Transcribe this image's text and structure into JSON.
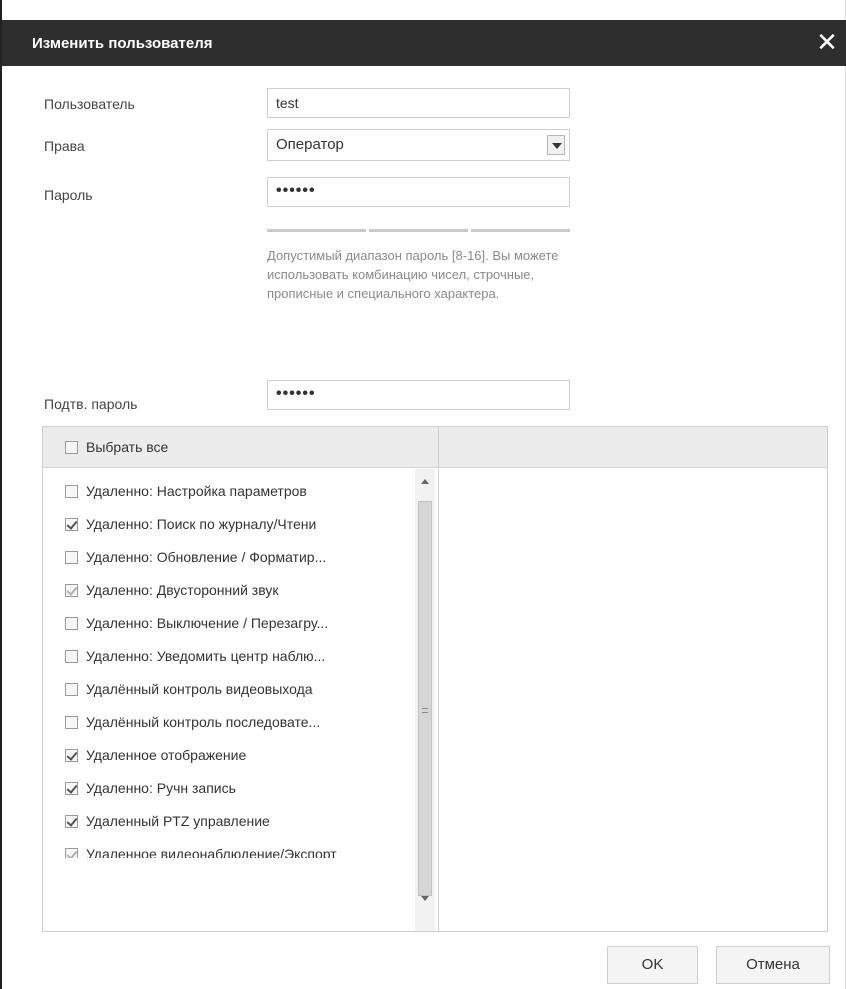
{
  "dialog": {
    "title": "Изменить пользователя",
    "close_icon": "close-icon"
  },
  "form": {
    "user_label": "Пользователь",
    "user_value": "test",
    "rights_label": "Права",
    "rights_selected": "Оператор",
    "password_label": "Пароль",
    "password_value": "••••••",
    "password_hint": "Допустимый диапазон пароль [8-16]. Вы можете использовать комбинацию чисел, строчные, прописные и специального характера.",
    "confirm_label": "Подтв. пароль",
    "confirm_value": "••••••"
  },
  "permissions": {
    "select_all_label": "Выбрать все",
    "select_all_checked": false,
    "items": [
      {
        "label": "Удаленно: Настройка параметров",
        "checked": false
      },
      {
        "label": "Удаленно: Поиск по журналу/Чтени",
        "checked": true
      },
      {
        "label": "Удаленно: Обновление / Форматир...",
        "checked": false
      },
      {
        "label": "Удаленно: Двусторонний звук",
        "checked": true,
        "dim": true
      },
      {
        "label": "Удаленно: Выключение / Перезагру...",
        "checked": false
      },
      {
        "label": "Удаленно: Уведомить центр наблю...",
        "checked": false
      },
      {
        "label": "Удалённый контроль видеовыхода",
        "checked": false
      },
      {
        "label": "Удалённый контроль последовате...",
        "checked": false
      },
      {
        "label": "Удаленное отображение",
        "checked": true
      },
      {
        "label": "Удаленно: Ручн запись",
        "checked": true
      },
      {
        "label": "Удаленный PTZ управление",
        "checked": true
      },
      {
        "label": "Удаленное видеонаблюдение/Экспорт",
        "checked": true,
        "dim": true
      }
    ]
  },
  "buttons": {
    "ok": "OK",
    "cancel": "Отмена"
  }
}
